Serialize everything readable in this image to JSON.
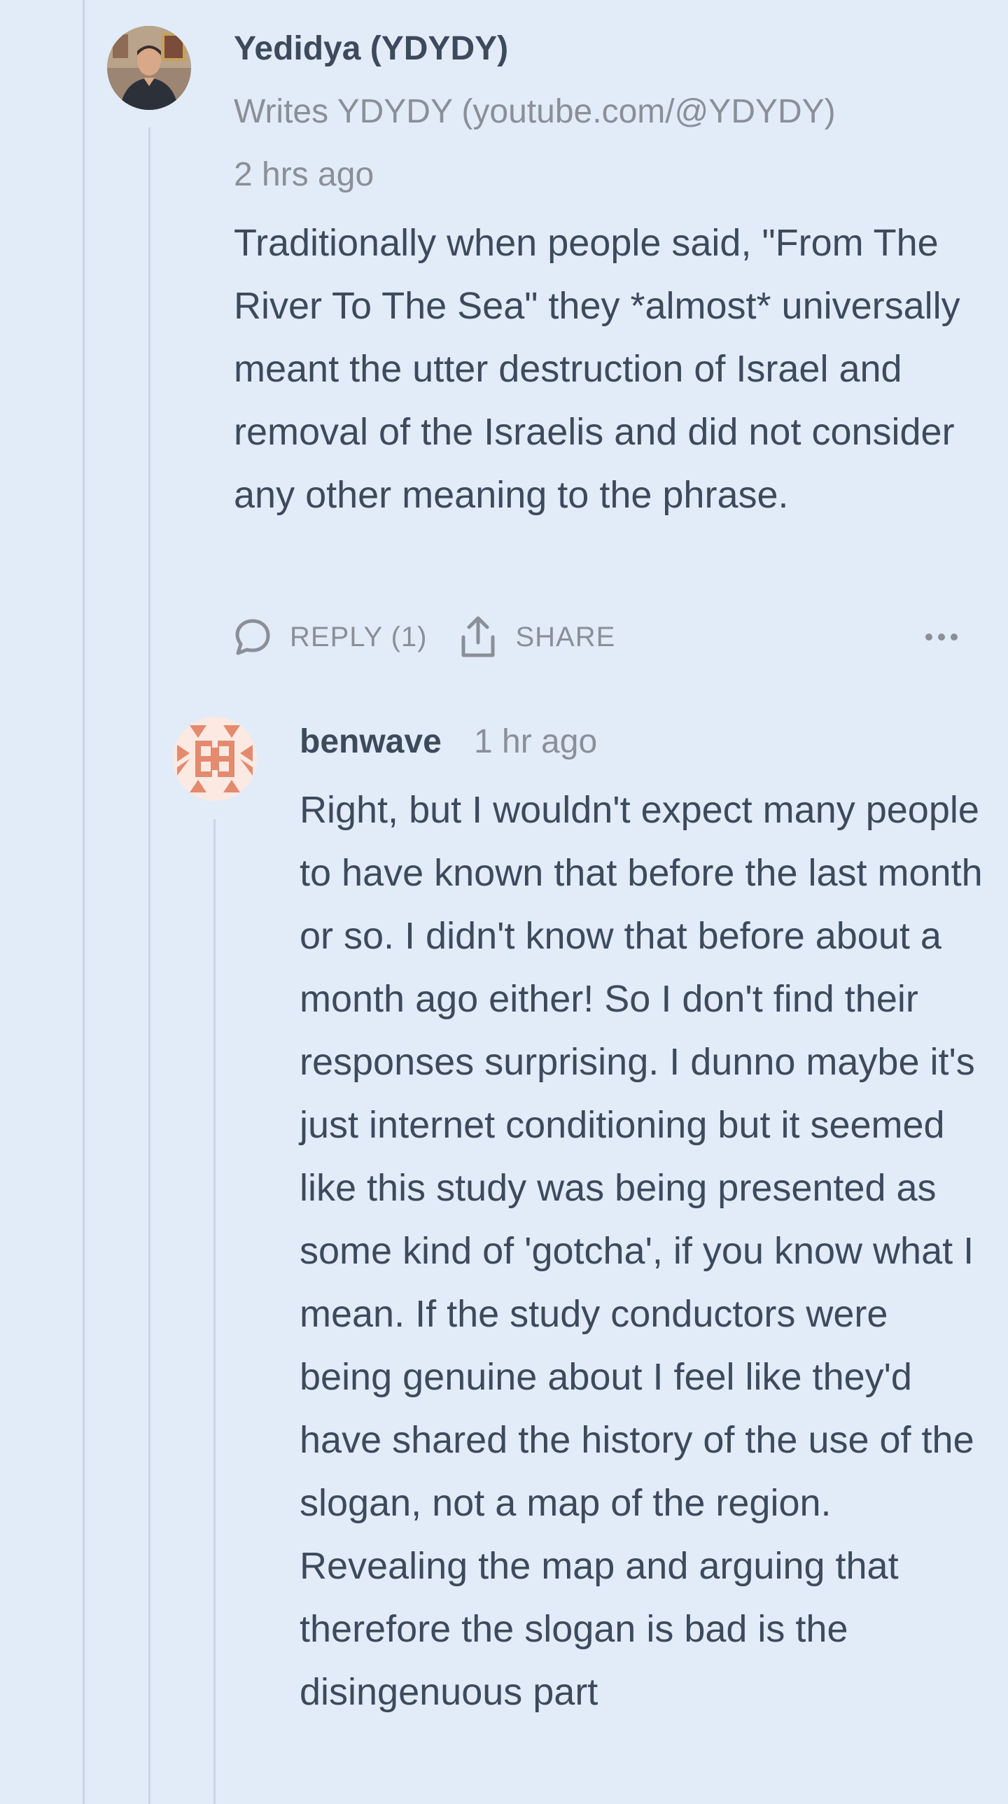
{
  "comment": {
    "author": "Yedidya (YDYDY)",
    "bio": "Writes YDYDY (youtube.com/@YDYDY)",
    "time": "2 hrs ago",
    "body": "Traditionally when people said, \"From The River To The Sea\" they *almost* universally meant the utter destruction of Israel and removal of the Israelis and did not consider any other meaning to the phrase.",
    "reply_label": "REPLY (1)",
    "share_label": "SHARE"
  },
  "reply": {
    "author": "benwave",
    "time": "1 hr ago",
    "body": "Right, but I wouldn't expect many people to have known that before the last month or so. I didn't know that before about a month ago either! So I don't find their responses surprising. I dunno maybe it's just internet conditioning but it seemed like this study was being presented as some kind of 'gotcha', if you know what I mean. If the study conductors were being genuine about I feel like they'd have shared the history of the use of the slogan, not a map of the region. Revealing the map and arguing that therefore the slogan is bad is the disingenuous part"
  },
  "icons": {
    "reply": "speech-bubble-icon",
    "share": "share-upload-icon",
    "more": "ellipsis-icon"
  },
  "colors": {
    "background": "#e2ecf9",
    "text": "#3d4a5c",
    "muted": "#8a8f98",
    "thread_line": "#c9d5e4",
    "identicon": "#e48a6e"
  }
}
